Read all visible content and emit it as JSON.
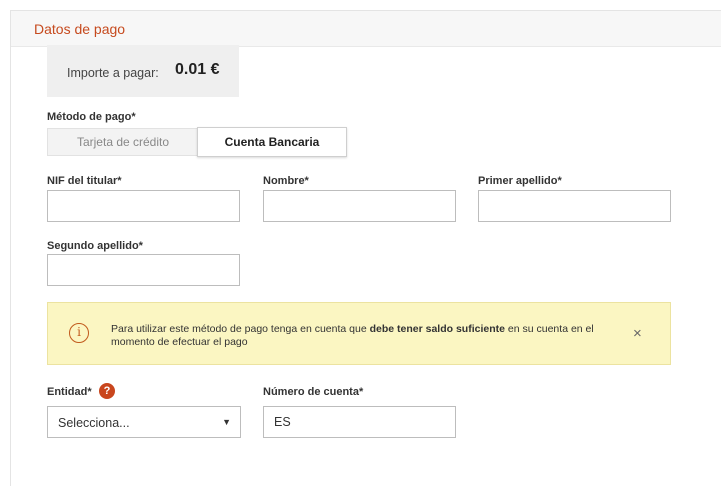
{
  "panel": {
    "title": "Datos de pago"
  },
  "amount": {
    "label": "Importe a pagar:",
    "value": "0.01 €"
  },
  "payment_method": {
    "label": "Método de pago*",
    "options": [
      "Tarjeta de crédito",
      "Cuenta Bancaria"
    ],
    "selected": "Cuenta Bancaria"
  },
  "fields": {
    "nif_label": "NIF del titular*",
    "nif_value": "",
    "nombre_label": "Nombre*",
    "nombre_value": "",
    "primer_apellido_label": "Primer apellido*",
    "primer_apellido_value": "",
    "segundo_apellido_label": "Segundo apellido*",
    "segundo_apellido_value": ""
  },
  "alert": {
    "text_before": "Para utilizar este método de pago tenga en cuenta que ",
    "text_bold": "debe tener saldo suficiente",
    "text_after": " en su cuenta en el momento de efectuar el pago",
    "icon": "info-icon",
    "close_glyph": "×"
  },
  "entidad": {
    "label": "Entidad*",
    "help_glyph": "?",
    "selected": "Selecciona..."
  },
  "cuenta": {
    "label": "Número de cuenta*",
    "value": "ES"
  },
  "colors": {
    "accent": "#c64a1e",
    "alert_bg": "#fbf6c2",
    "help_badge": "#c9461d"
  }
}
